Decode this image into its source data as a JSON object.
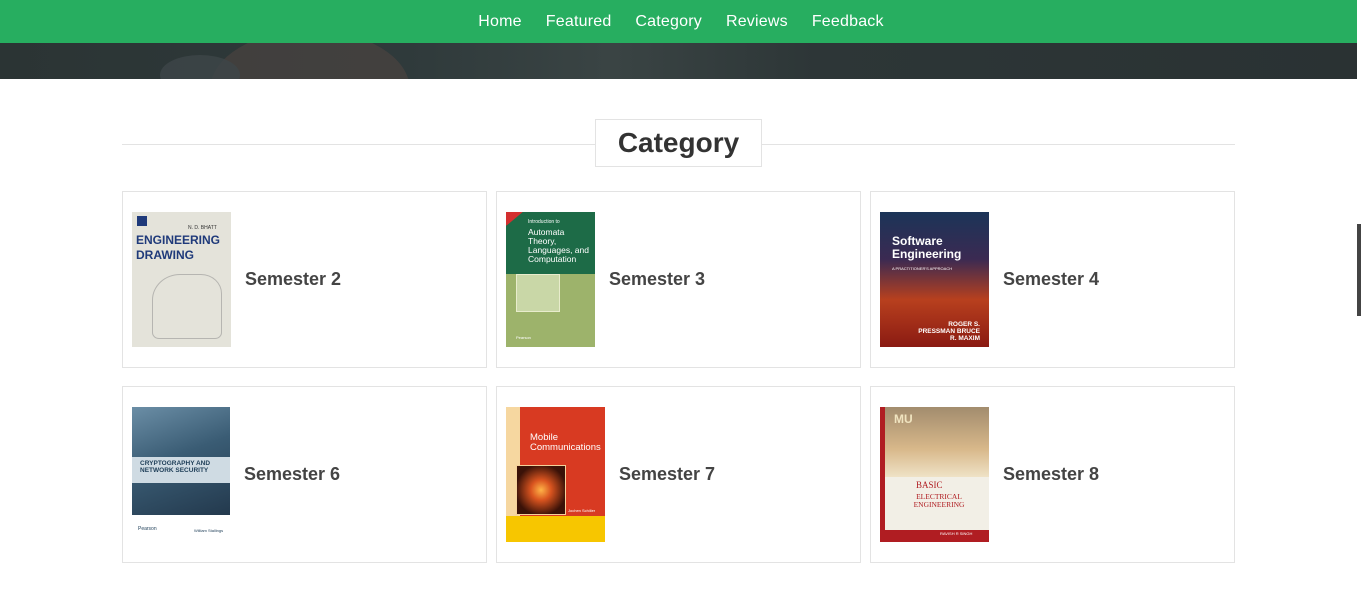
{
  "nav": {
    "items": [
      {
        "label": "Home"
      },
      {
        "label": "Featured"
      },
      {
        "label": "Category"
      },
      {
        "label": "Reviews"
      },
      {
        "label": "Feedback"
      }
    ]
  },
  "section": {
    "title": "Category"
  },
  "categories": [
    {
      "label": "Semester 2",
      "cover": {
        "author": "N. D. BHATT",
        "title_line1": "ENGINEERING",
        "title_line2": "DRAWING"
      }
    },
    {
      "label": "Semester 3",
      "cover": {
        "title_prefix": "Introduction to",
        "title": "Automata Theory, Languages, and Computation",
        "publisher": "Pearson"
      }
    },
    {
      "label": "Semester 4",
      "cover": {
        "title": "Software Engineering",
        "subtitle": "A PRACTITIONER'S APPROACH",
        "authors": "ROGER S. PRESSMAN BRUCE R. MAXIM"
      }
    },
    {
      "label": "Semester 6",
      "cover": {
        "title": "CRYPTOGRAPHY AND NETWORK SECURITY",
        "publisher": "Pearson",
        "author": "William Stallings"
      }
    },
    {
      "label": "Semester 7",
      "cover": {
        "title": "Mobile Communications",
        "author": "Jochen Schiller"
      }
    },
    {
      "label": "Semester 8",
      "cover": {
        "series": "MU",
        "title_line1": "BASIC",
        "title_line2": "ELECTRICAL ENGINEERING",
        "author": "RAVISH R SINGH"
      }
    }
  ],
  "colors": {
    "nav_background": "#27ae60",
    "nav_text": "#ffffff",
    "heading_text": "#333333",
    "card_border": "#e3e3e3"
  }
}
